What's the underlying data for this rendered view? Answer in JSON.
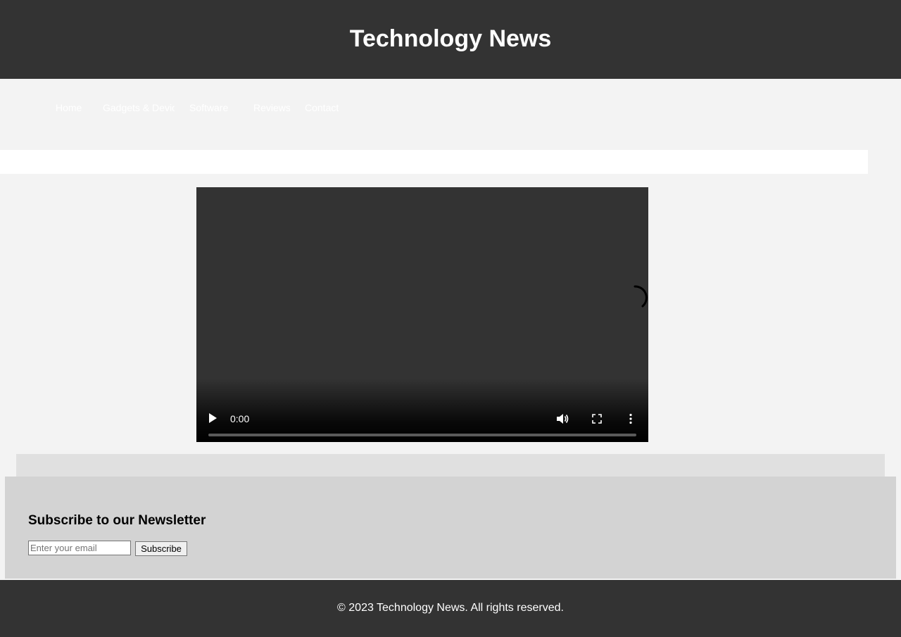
{
  "header": {
    "title": "Technology News"
  },
  "nav": {
    "items": [
      {
        "label": "Home"
      },
      {
        "label": "Gadgets & Devices"
      },
      {
        "label": "Software"
      },
      {
        "label": "Reviews"
      },
      {
        "label": "Contact"
      }
    ]
  },
  "video": {
    "time": "0:00",
    "progress": 0,
    "icons": {
      "play": "play-icon",
      "volume": "volume-icon",
      "fullscreen": "fullscreen-icon",
      "more": "more-options-icon",
      "loading": "loading-spinner-icon"
    }
  },
  "newsletter": {
    "title": "Subscribe to our Newsletter",
    "email_placeholder": "Enter your email",
    "subscribe_label": "Subscribe"
  },
  "footer": {
    "text": "© 2023 Technology News. All rights reserved."
  },
  "colors": {
    "header_bg": "#333333",
    "page_bg": "#f3f3f3",
    "newsletter_bg": "#d3d3d3",
    "text_light": "#ffffff"
  }
}
